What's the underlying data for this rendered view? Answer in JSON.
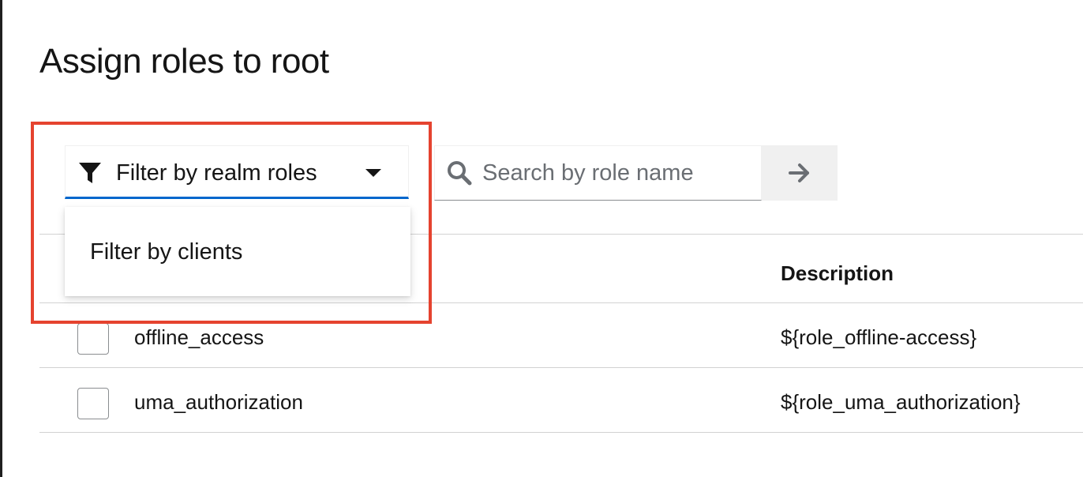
{
  "page": {
    "title": "Assign roles to root"
  },
  "toolbar": {
    "filter_label": "Filter by realm roles",
    "search_placeholder": "Search by role name",
    "search_value": ""
  },
  "dropdown": {
    "items": [
      {
        "label": "Filter by clients"
      }
    ]
  },
  "table": {
    "columns": [
      "",
      "Description"
    ],
    "rows": [
      {
        "name": "offline_access",
        "description": "${role_offline-access}",
        "checked": false
      },
      {
        "name": "uma_authorization",
        "description": "${role_uma_authorization}",
        "checked": false
      }
    ]
  },
  "colors": {
    "accent": "#0066cc",
    "annotation": "#e5432f",
    "text": "#151515",
    "placeholder": "#6a6e73",
    "submit_bg": "#f0f0f0"
  },
  "icons": {
    "filter": "filter-icon",
    "caret": "caret-down-icon",
    "search": "search-icon",
    "submit": "arrow-right-icon"
  }
}
